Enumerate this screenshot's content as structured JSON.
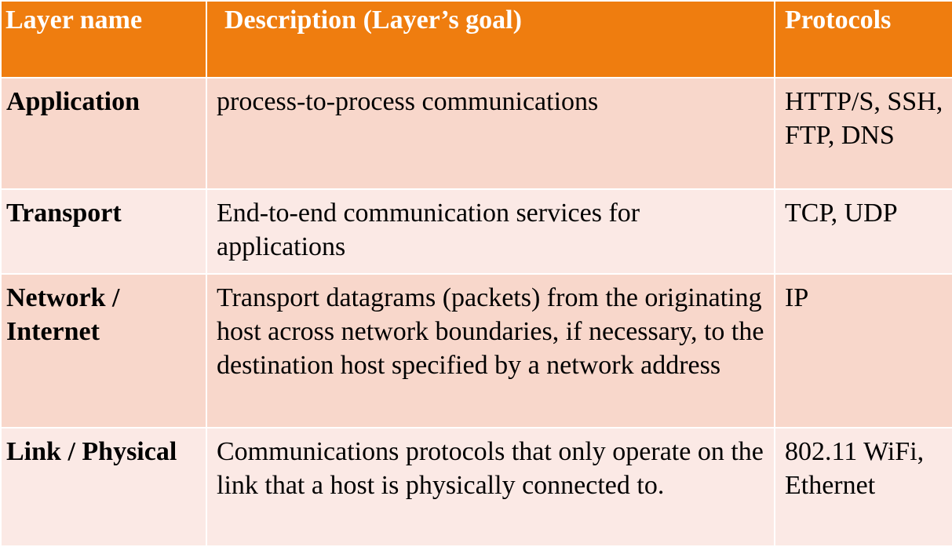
{
  "headers": {
    "layer_name": "Layer name",
    "description": "Description (Layer’s goal)",
    "protocols": "Protocols"
  },
  "rows": [
    {
      "name": "Application",
      "description": "process-to-process communications",
      "protocols": "HTTP/S, SSH, FTP, DNS"
    },
    {
      "name": "Transport",
      "description": "End-to-end communication services for applications",
      "protocols": "TCP, UDP"
    },
    {
      "name": "Network / Internet",
      "description": "Transport datagrams (packets) from the originating host across network boundaries, if necessary, to the destination host specified by a network address",
      "protocols": "IP"
    },
    {
      "name": "Link / Physical",
      "description": "Communications protocols that only operate on the link that a host is physically connected to.",
      "protocols": "802.11 WiFi, Ethernet"
    }
  ],
  "colors": {
    "header_bg": "#ef7d0f",
    "row_dark": "#f8d7cb",
    "row_light": "#fbe9e5"
  }
}
